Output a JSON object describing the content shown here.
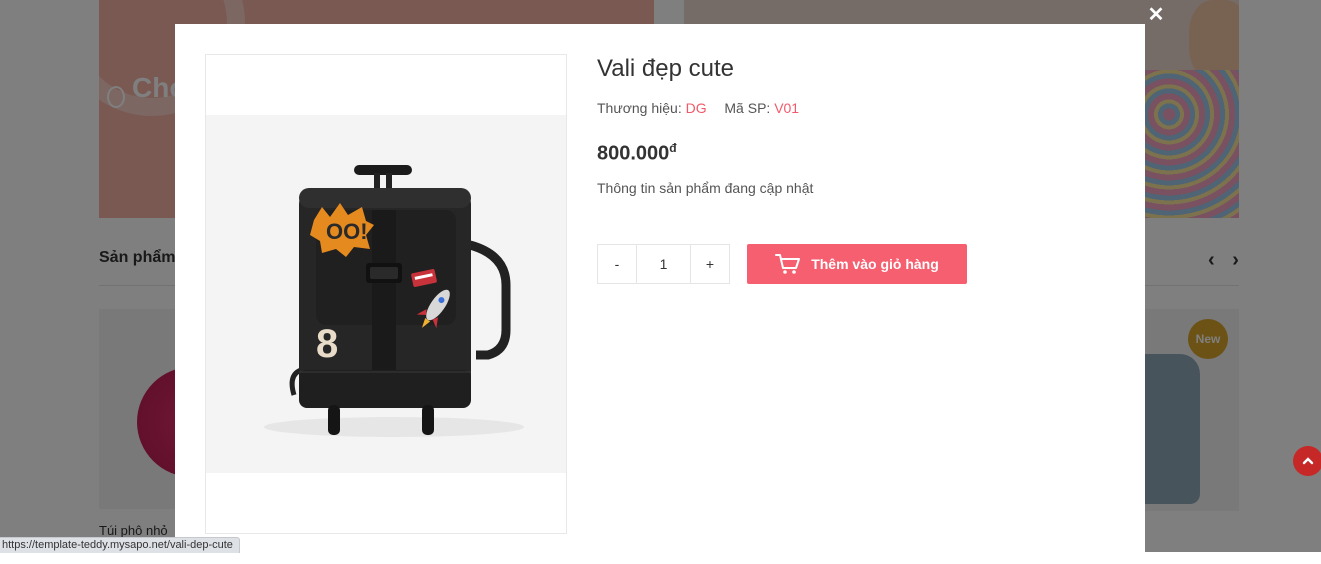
{
  "background": {
    "banner_left_word": "Cho",
    "section_title": "Sản phẩm",
    "nav_arrows": "‹ ›",
    "card_left_label": "Túi phô nhỏ",
    "badge_new": "New",
    "back_to_top_icon": "chevron-up-icon"
  },
  "modal": {
    "close_symbol": "✕",
    "product": {
      "title": "Vali đẹp cute",
      "brand_label": "Thương hiệu:",
      "brand_value": "DG",
      "sku_label": "Mã SP:",
      "sku_value": "V01",
      "price": "800.000",
      "currency": "đ",
      "description": "Thông tin sản phẩm đang cập nhật",
      "image_alt": "suitcase-backpack-image"
    },
    "quantity": {
      "minus_label": "-",
      "value": "1",
      "plus_label": "+"
    },
    "add_to_cart_label": "Thêm vào giỏ hàng"
  },
  "status_bar": {
    "url": "https://template-teddy.mysapo.net/vali-dep-cute"
  },
  "colors": {
    "accent": "#f65f6f",
    "meta_value": "#f05a6a",
    "badge_new": "#d9a52a",
    "back_to_top": "#c62828"
  }
}
